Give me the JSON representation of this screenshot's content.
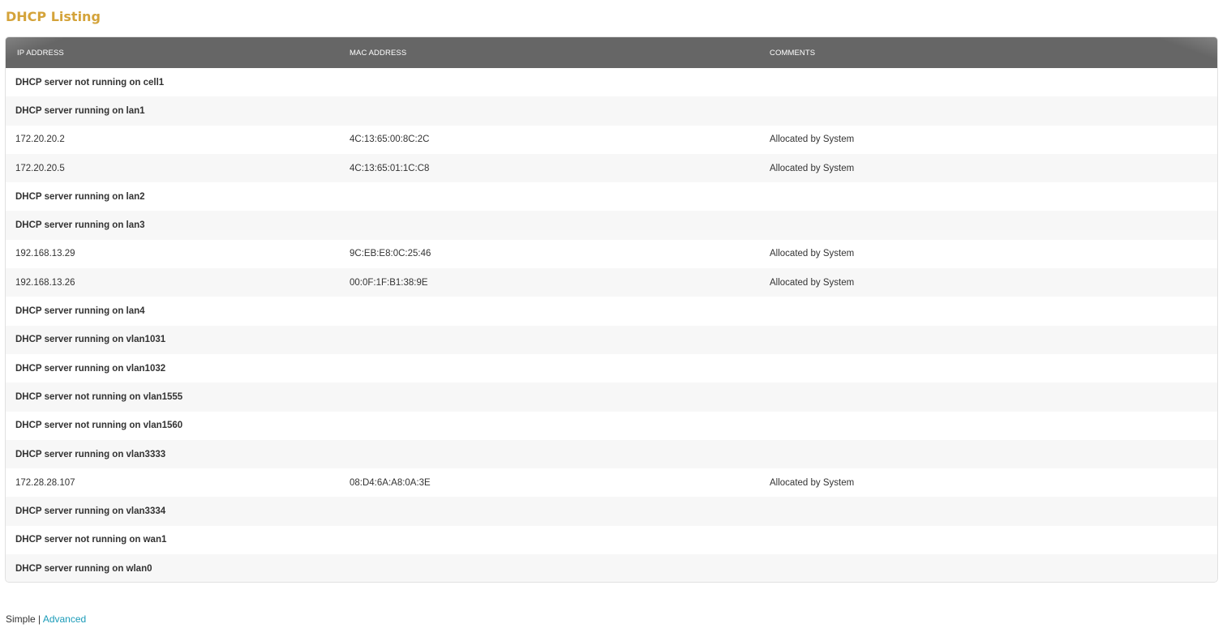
{
  "page": {
    "title": "DHCP Listing"
  },
  "table": {
    "headers": {
      "ip": "IP ADDRESS",
      "mac": "MAC ADDRESS",
      "comments": "COMMENTS"
    },
    "rows": [
      {
        "type": "group",
        "label": "DHCP server not running on cell1"
      },
      {
        "type": "group",
        "label": "DHCP server running on lan1"
      },
      {
        "type": "lease",
        "ip": "172.20.20.2",
        "mac": "4C:13:65:00:8C:2C",
        "comment": "Allocated by System"
      },
      {
        "type": "lease",
        "ip": "172.20.20.5",
        "mac": "4C:13:65:01:1C:C8",
        "comment": "Allocated by System"
      },
      {
        "type": "group",
        "label": "DHCP server running on lan2"
      },
      {
        "type": "group",
        "label": "DHCP server running on lan3"
      },
      {
        "type": "lease",
        "ip": "192.168.13.29",
        "mac": "9C:EB:E8:0C:25:46",
        "comment": "Allocated by System"
      },
      {
        "type": "lease",
        "ip": "192.168.13.26",
        "mac": "00:0F:1F:B1:38:9E",
        "comment": "Allocated by System"
      },
      {
        "type": "group",
        "label": "DHCP server running on lan4"
      },
      {
        "type": "group",
        "label": "DHCP server running on vlan1031"
      },
      {
        "type": "group",
        "label": "DHCP server running on vlan1032"
      },
      {
        "type": "group",
        "label": "DHCP server not running on vlan1555"
      },
      {
        "type": "group",
        "label": "DHCP server not running on vlan1560"
      },
      {
        "type": "group",
        "label": "DHCP server running on vlan3333"
      },
      {
        "type": "lease",
        "ip": "172.28.28.107",
        "mac": "08:D4:6A:A8:0A:3E",
        "comment": "Allocated by System"
      },
      {
        "type": "group",
        "label": "DHCP server running on vlan3334"
      },
      {
        "type": "group",
        "label": "DHCP server not running on wan1"
      },
      {
        "type": "group",
        "label": "DHCP server running on wlan0"
      }
    ]
  },
  "footer": {
    "simple_label": "Simple",
    "separator": "|",
    "advanced_label": "Advanced"
  },
  "colors": {
    "title": "#d4a33a",
    "header_bg": "#666666",
    "link": "#1a9bb8",
    "row_alt": "#f7f7f7"
  }
}
